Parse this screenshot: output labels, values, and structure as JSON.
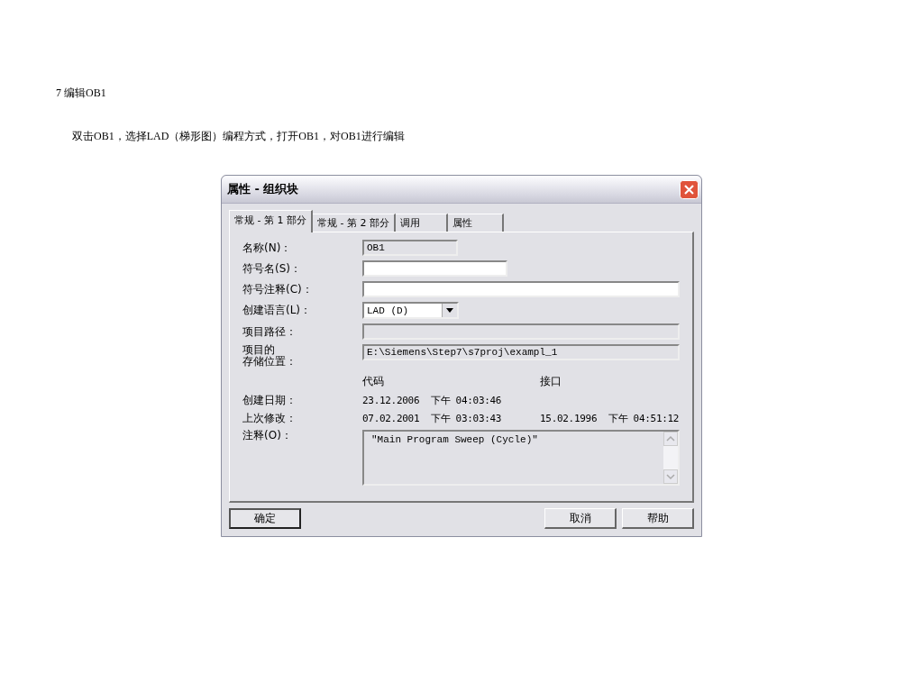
{
  "document": {
    "heading": "7 编辑OB1",
    "instruction": "双击OB1，选择LAD（梯形图）编程方式，打开OB1，对OB1进行编辑"
  },
  "dialog": {
    "title": "属性 - 组织块",
    "tabs": [
      {
        "label": "常规 - 第 1 部分",
        "selected": true
      },
      {
        "label": "常规 - 第 2 部分",
        "selected": false
      },
      {
        "label": "调用",
        "selected": false
      },
      {
        "label": "属性",
        "selected": false
      }
    ],
    "fields": [
      {
        "label": "名称(N)：",
        "kind": "readonly",
        "value": "OB1"
      },
      {
        "label": "符号名(S)：",
        "kind": "text"
      },
      {
        "label": "符号注释(C)：",
        "kind": "text"
      },
      {
        "label": "创建语言(L)：",
        "kind": "combo",
        "value": "LAD (D)"
      },
      {
        "label": "项目路径：",
        "kind": "readonly"
      },
      {
        "label_lines": [
          "项目的",
          "存储位置："
        ],
        "kind": "readonly",
        "value": "E:\\Siemens\\Step7\\s7proj\\exampl_1"
      }
    ],
    "dates": {
      "headers": [
        "代码",
        "接口"
      ],
      "rows": [
        {
          "label": "创建日期：",
          "code": "23.12.2006  下午 04:03:46"
        },
        {
          "label": "上次修改：",
          "code": "07.02.2001  下午 03:03:43",
          "interface": "15.02.1996  下午 04:51:12"
        }
      ]
    },
    "comment": {
      "label": "注释(O)：",
      "value": "\"Main Program Sweep (Cycle)\""
    },
    "buttons": [
      {
        "label": "确定",
        "default": true
      },
      {
        "label": "取消",
        "default": false
      },
      {
        "label": "帮助",
        "default": false
      }
    ]
  }
}
